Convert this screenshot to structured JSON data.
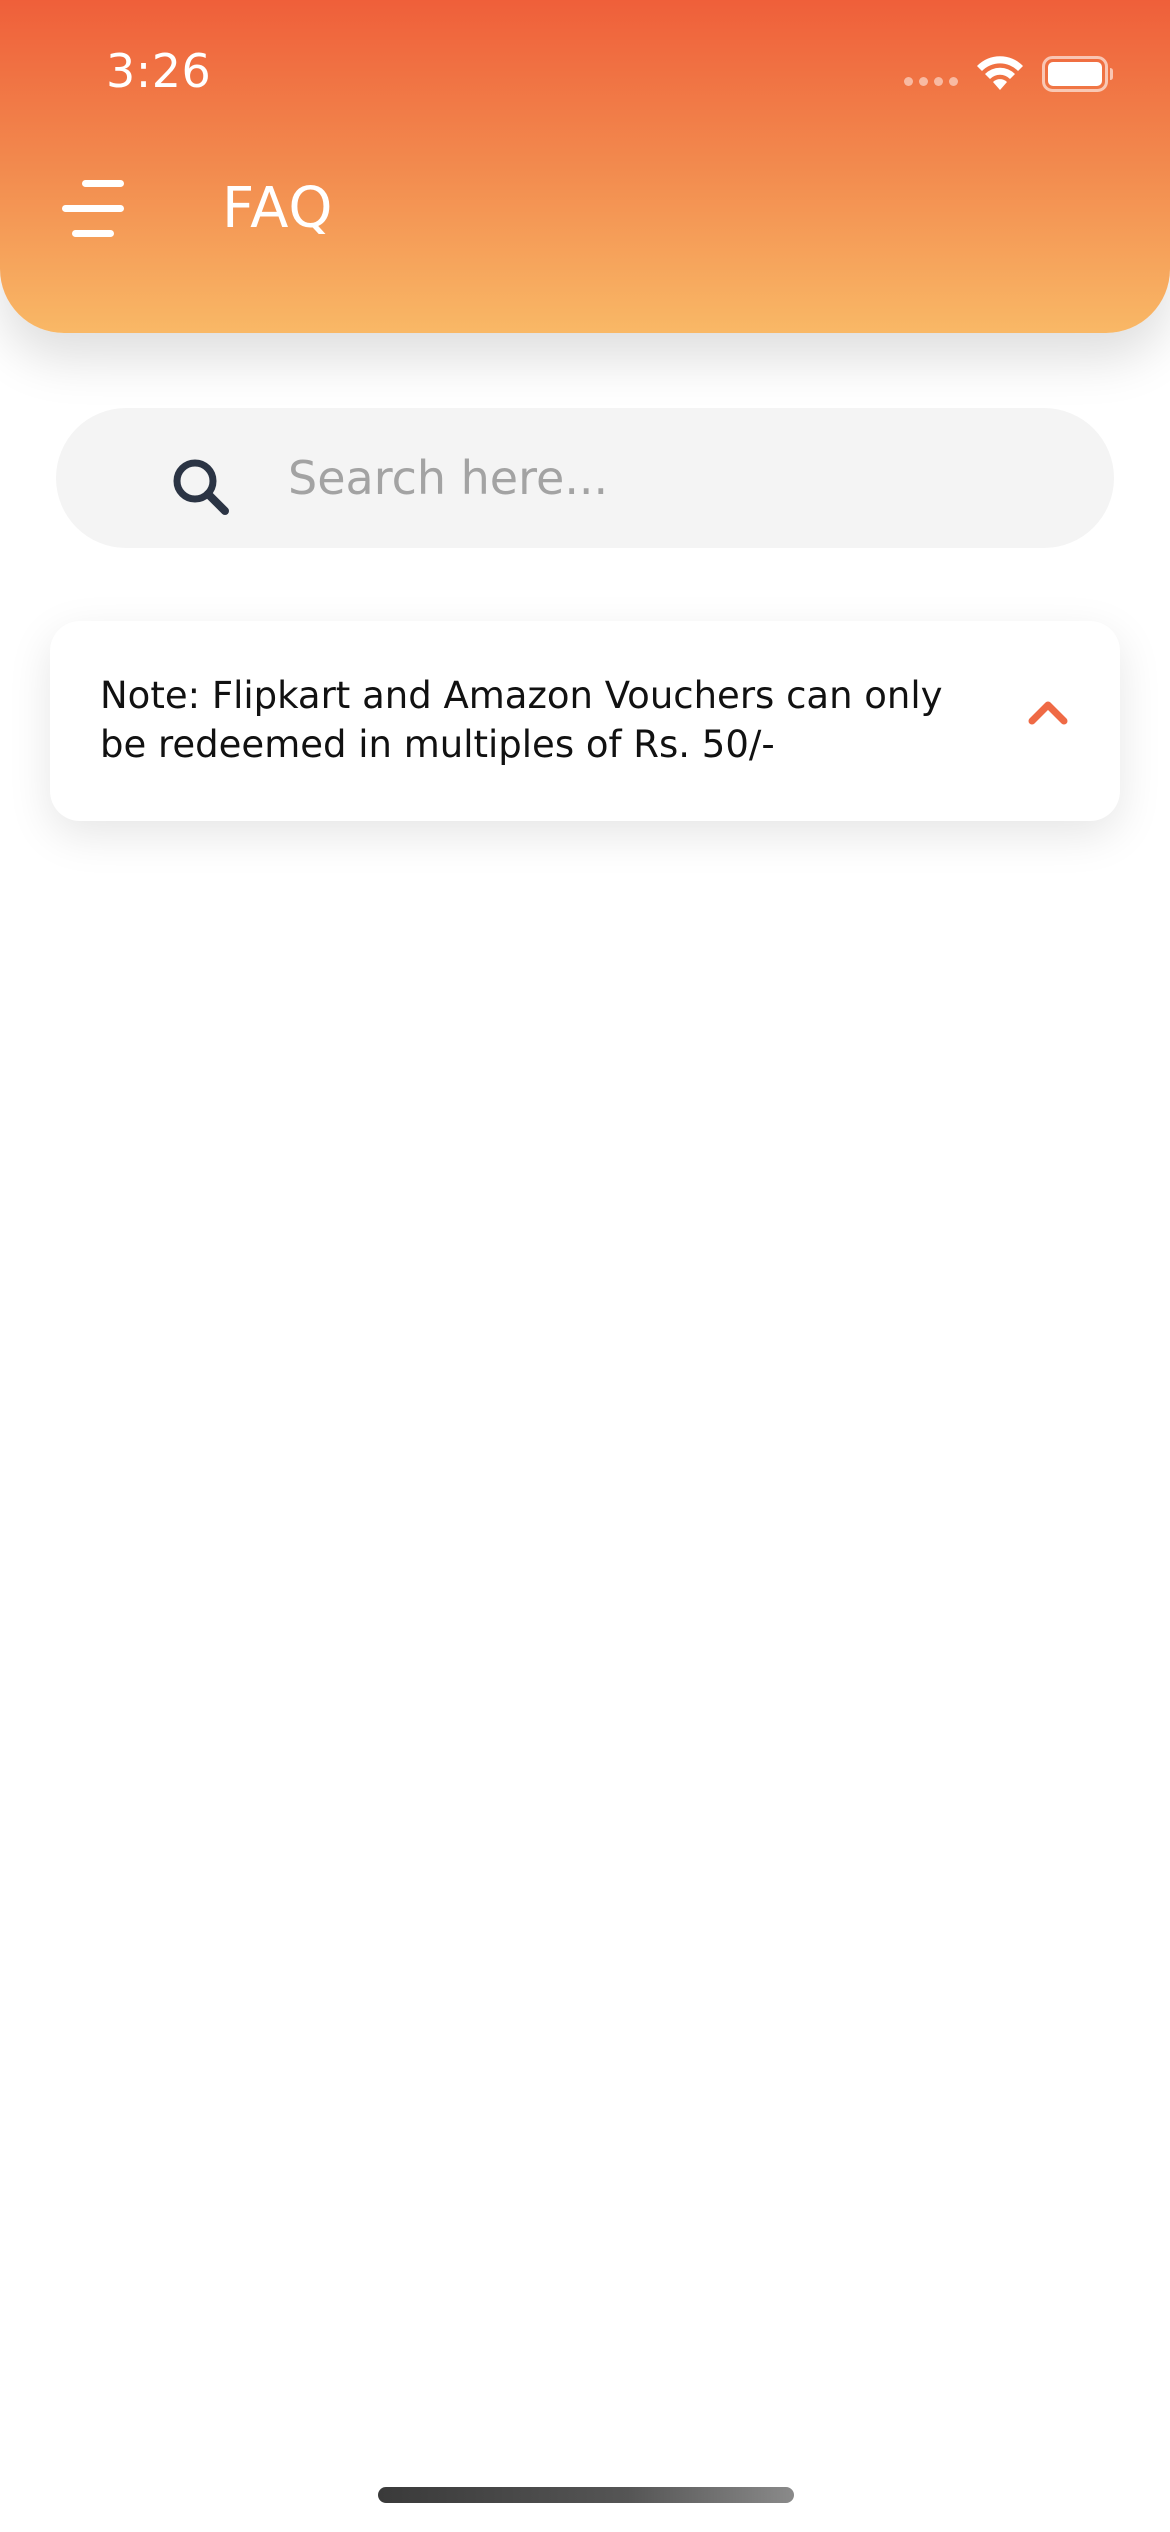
{
  "status_bar": {
    "time": "3:26"
  },
  "header": {
    "title": "FAQ",
    "gradient_top": "#ef5f3a",
    "gradient_bottom": "#f9b866"
  },
  "search": {
    "placeholder": "Search here...",
    "value": ""
  },
  "faq_items": [
    {
      "question": "Note: Flipkart and Amazon Vouchers can only be redeemed in multiples of Rs. 50/-",
      "expanded": true
    }
  ],
  "icons": {
    "menu": "menu-icon",
    "search": "search-icon",
    "chevron": "chevron-up-icon",
    "wifi": "wifi-icon",
    "battery": "battery-icon"
  },
  "colors": {
    "accent": "#ef6a45",
    "search_bg": "#f4f4f4",
    "search_icon": "#2b3444"
  }
}
